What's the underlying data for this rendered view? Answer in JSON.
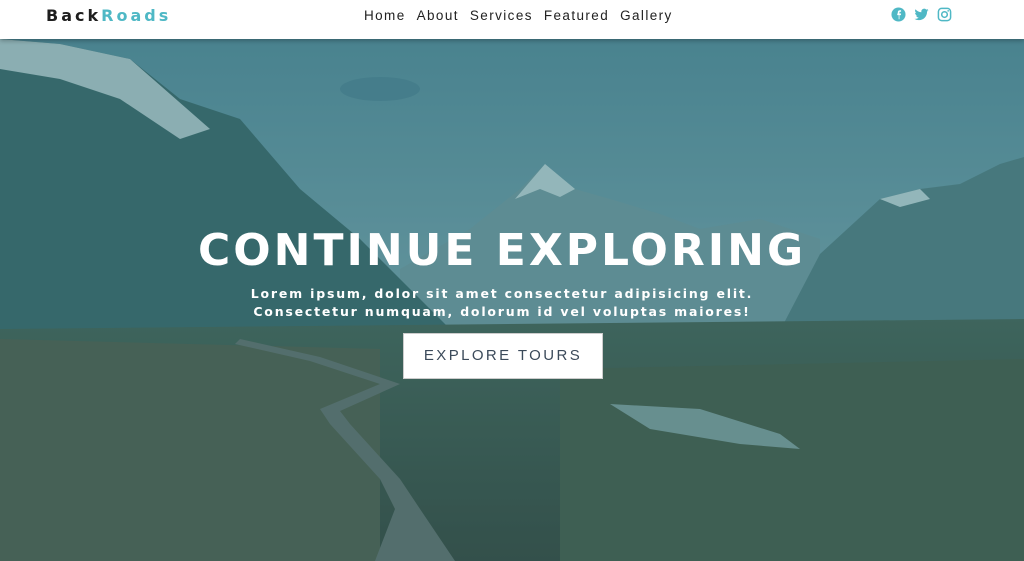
{
  "brand": {
    "part1": "Back",
    "part2": "Roads",
    "accent_color": "#4fb8c5"
  },
  "nav": {
    "links": [
      {
        "label": "Home"
      },
      {
        "label": "About"
      },
      {
        "label": "Services"
      },
      {
        "label": "Featured"
      },
      {
        "label": "Gallery"
      }
    ]
  },
  "social": {
    "icons": [
      "facebook-icon",
      "twitter-icon",
      "instagram-icon"
    ],
    "color": "#4fb8c5"
  },
  "hero": {
    "title": "CONTINUE EXPLORING",
    "subtitle_line1": "Lorem ipsum, dolor sit amet consectetur adipisicing elit.",
    "subtitle_line2": "Consectetur numquam, dolorum id vel voluptas maiores!",
    "button_label": "EXPLORE TOURS"
  }
}
